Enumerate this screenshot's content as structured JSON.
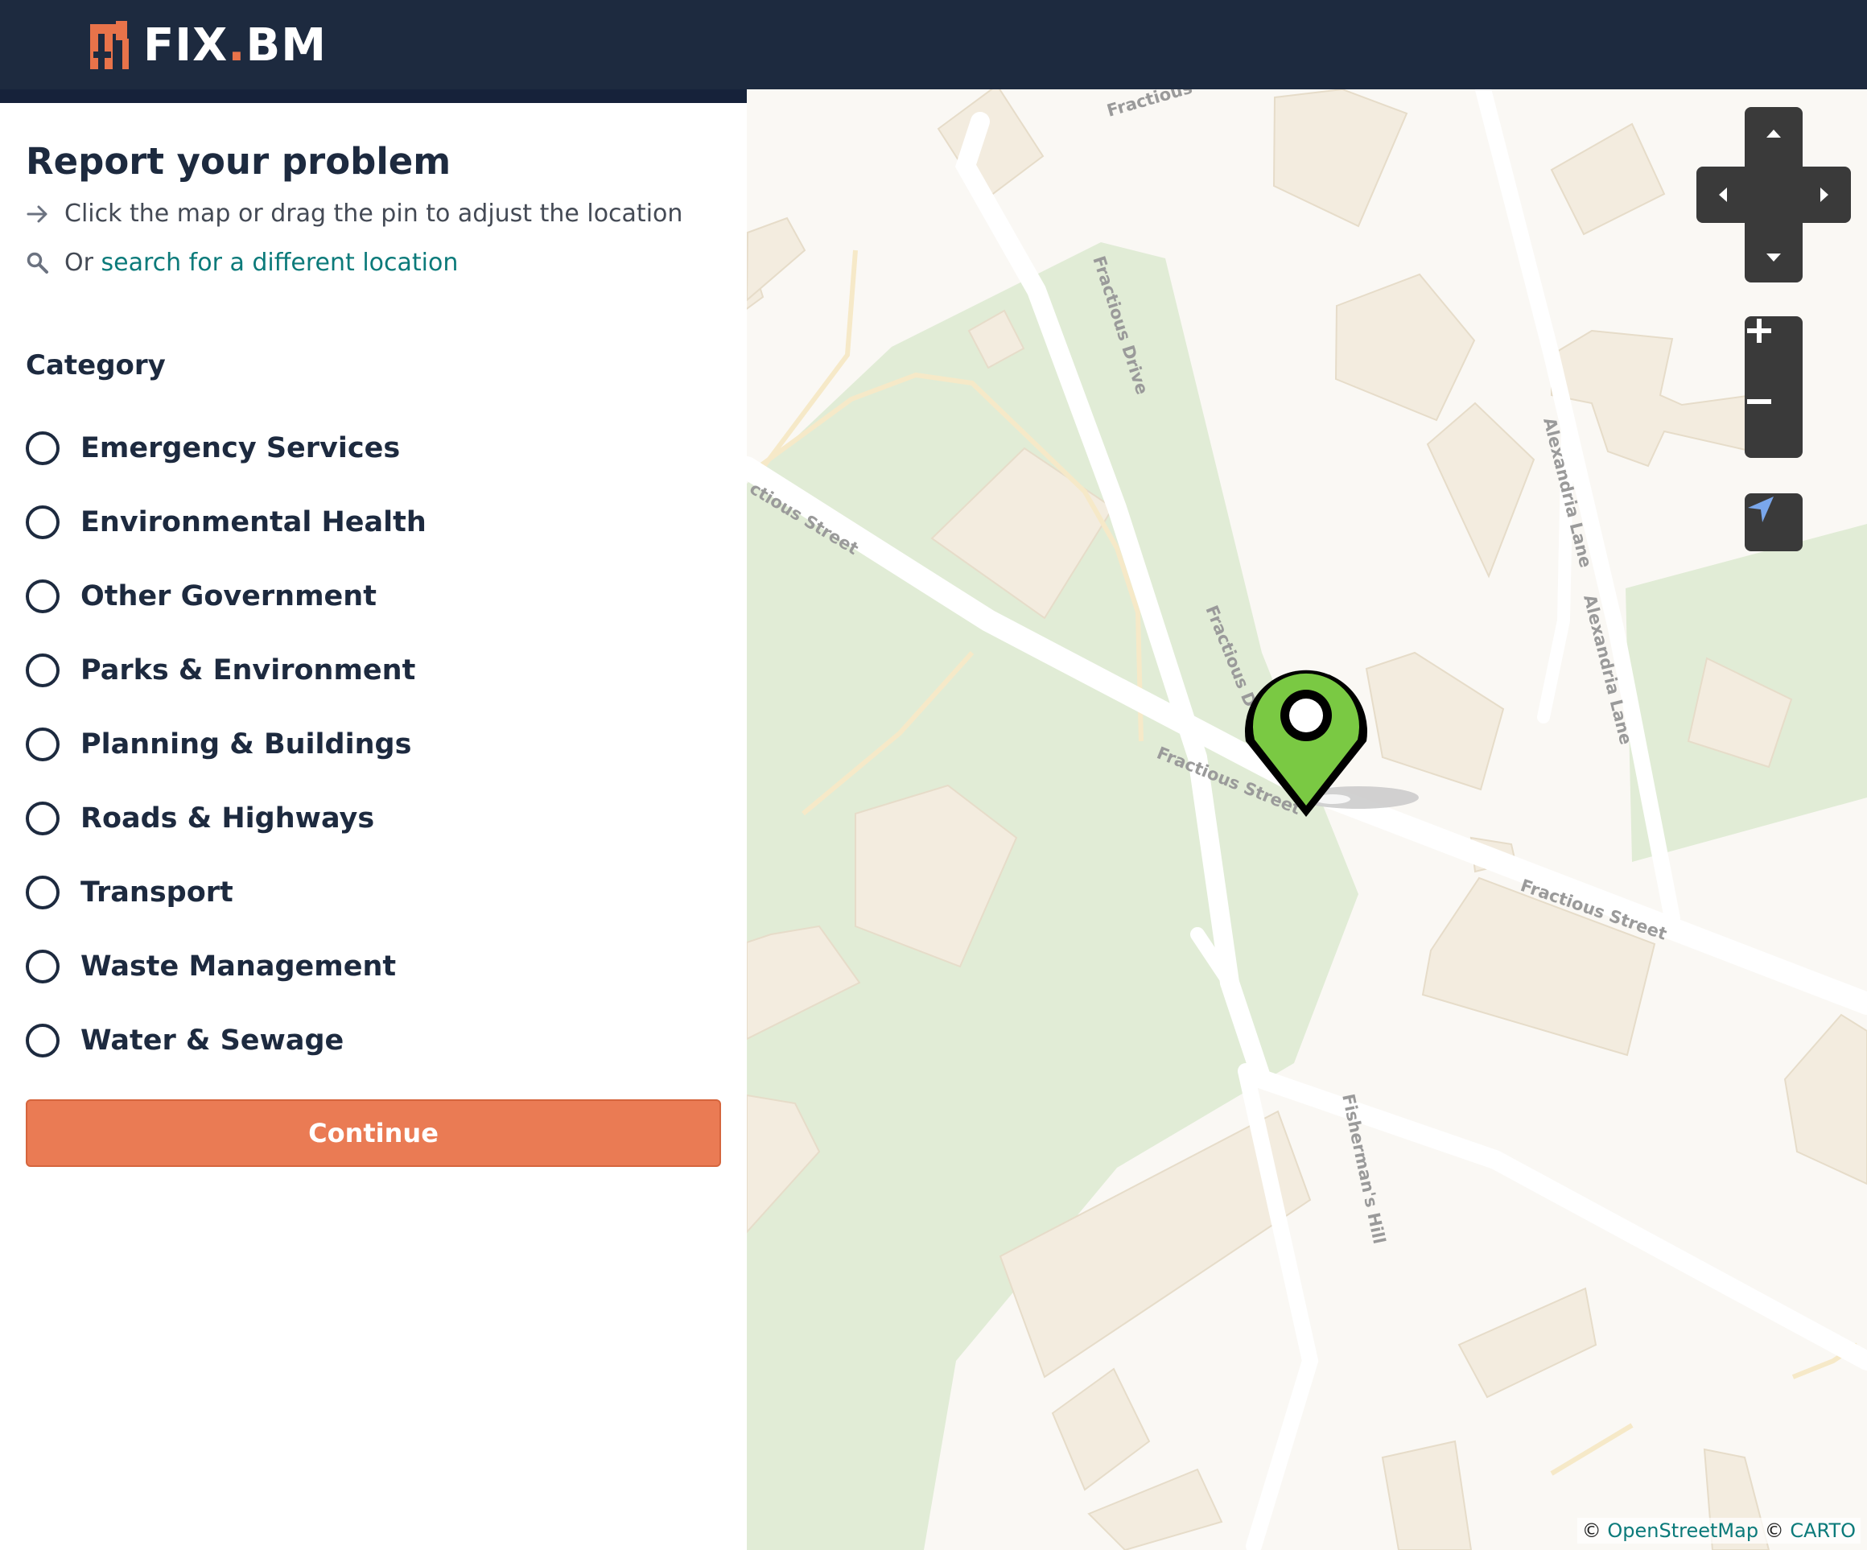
{
  "header": {
    "logo_text_main": "FIX",
    "logo_text_dot": ".",
    "logo_text_end": "BM"
  },
  "sidebar": {
    "title": "Report your problem",
    "hint_adjust": "Click the map or drag the pin to adjust the location",
    "hint_search_prefix": "Or ",
    "hint_search_link": "search for a different location",
    "category_label": "Category",
    "categories": [
      "Emergency Services",
      "Environmental Health",
      "Other Government",
      "Parks & Environment",
      "Planning & Buildings",
      "Roads & Highways",
      "Transport",
      "Waste Management",
      "Water & Sewage"
    ],
    "continue_label": "Continue"
  },
  "map": {
    "street_labels": {
      "fractious_top": "Fractious",
      "fractious_drive_1": "Fractious Drive",
      "fractious_drive_2": "Fractious D",
      "alexandria_1": "Alexandria Lane",
      "alexandria_2": "Alexandria Lane",
      "fractious_street_left": "ctious Street",
      "fractious_street_mid": "Fractious Street",
      "fractious_street_right": "Fractious Street",
      "fishermans_hill": "Fisherman's Hill"
    },
    "attribution": {
      "copyright_1": "©",
      "osm_link": "OpenStreetMap",
      "copyright_2": "©",
      "carto_link": "CARTO"
    },
    "pin_color": "#7ac943"
  },
  "colors": {
    "header_bg": "#1d2a3f",
    "accent_orange": "#ea7b54",
    "link_teal": "#0b7a7a",
    "park_green": "#e1ecd6",
    "building": "#f3ecdf"
  },
  "icons": {
    "arrow": "arrow-right-icon",
    "search": "search-icon",
    "pan": "pan-arrows-icon",
    "zoom_in": "plus-icon",
    "zoom_out": "minus-icon",
    "locate": "location-arrow-icon",
    "pin": "map-pin-icon"
  }
}
